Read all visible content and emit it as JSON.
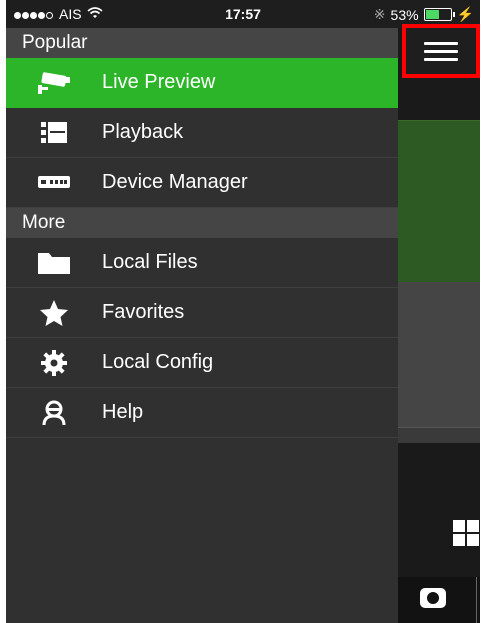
{
  "status_bar": {
    "carrier": "AIS",
    "time": "17:57",
    "battery": "53%"
  },
  "menu": {
    "sections": [
      {
        "title": "Popular",
        "items": [
          {
            "label": "Live Preview",
            "icon": "cctv-camera-icon",
            "active": true
          },
          {
            "label": "Playback",
            "icon": "film-strip-icon",
            "active": false
          },
          {
            "label": "Device Manager",
            "icon": "dvr-device-icon",
            "active": false
          }
        ]
      },
      {
        "title": "More",
        "items": [
          {
            "label": "Local Files",
            "icon": "folder-icon",
            "active": false
          },
          {
            "label": "Favorites",
            "icon": "star-icon",
            "active": false
          },
          {
            "label": "Local Config",
            "icon": "gear-icon",
            "active": false
          },
          {
            "label": "Help",
            "icon": "person-icon",
            "active": false
          }
        ]
      }
    ]
  },
  "colors": {
    "accent_active": "#2db52a",
    "highlight_box": "#ff0000"
  }
}
